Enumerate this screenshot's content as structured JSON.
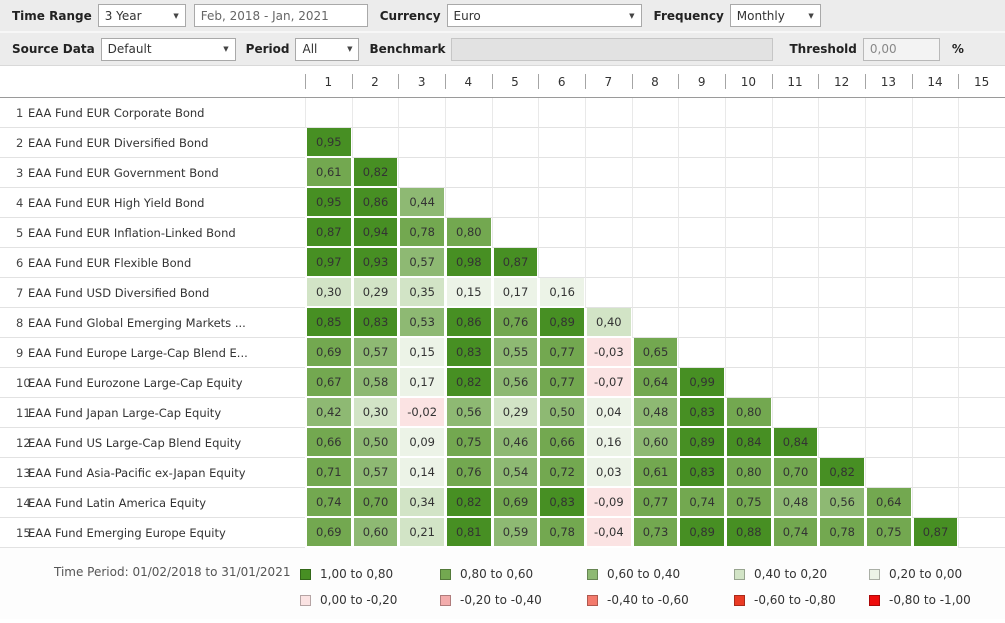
{
  "icons": {
    "dropdown_arrow": "▼"
  },
  "toolbar": {
    "time_range_label": "Time Range",
    "time_range_value": "3 Year",
    "date_range_value": "Feb, 2018 - Jan, 2021",
    "currency_label": "Currency",
    "currency_value": "Euro",
    "frequency_label": "Frequency",
    "frequency_value": "Monthly",
    "source_data_label": "Source Data",
    "source_data_value": "Default",
    "period_label": "Period",
    "period_value": "All",
    "benchmark_label": "Benchmark",
    "benchmark_value": "",
    "threshold_label": "Threshold",
    "threshold_value": "0,00",
    "threshold_unit": "%"
  },
  "footer": {
    "time_period": "Time Period: 01/02/2018 to 31/01/2021"
  },
  "chart_data": {
    "type": "heatmap",
    "title": "Correlation Matrix",
    "columns": [
      "1",
      "2",
      "3",
      "4",
      "5",
      "6",
      "7",
      "8",
      "9",
      "10",
      "11",
      "12",
      "13",
      "14",
      "15"
    ],
    "band_thresholds": [
      0.8,
      0.6,
      0.4,
      0.2,
      0,
      -0.2,
      -0.4,
      -0.6,
      -0.8
    ],
    "legend": {
      "items": [
        {
          "label": "1,00 to 0,80",
          "color": "#478f23"
        },
        {
          "label": "0,80 to 0,60",
          "color": "#73a850"
        },
        {
          "label": "0,60 to 0,40",
          "color": "#8eb973"
        },
        {
          "label": "0,40 to 0,20",
          "color": "#d2e4c6"
        },
        {
          "label": "0,20 to 0,00",
          "color": "#ecf3e7"
        },
        {
          "label": "0,00 to -0,20",
          "color": "#fbe3e3"
        },
        {
          "label": "-0,20 to -0,40",
          "color": "#f3acac"
        },
        {
          "label": "-0,40 to -0,60",
          "color": "#f37a6c"
        },
        {
          "label": "-0,60 to -0,80",
          "color": "#ea3b24"
        },
        {
          "label": "-0,80 to -1,00",
          "color": "#ee0c0c"
        }
      ]
    },
    "rows": [
      {
        "num": "1",
        "name": "EAA Fund EUR Corporate Bond",
        "values": []
      },
      {
        "num": "2",
        "name": "EAA Fund EUR Diversified Bond",
        "values": [
          "0,95"
        ]
      },
      {
        "num": "3",
        "name": "EAA Fund EUR Government Bond",
        "values": [
          "0,61",
          "0,82"
        ]
      },
      {
        "num": "4",
        "name": "EAA Fund EUR High Yield Bond",
        "values": [
          "0,95",
          "0,86",
          "0,44"
        ]
      },
      {
        "num": "5",
        "name": "EAA Fund EUR Inflation-Linked Bond",
        "values": [
          "0,87",
          "0,94",
          "0,78",
          "0,80"
        ]
      },
      {
        "num": "6",
        "name": "EAA Fund EUR Flexible Bond",
        "values": [
          "0,97",
          "0,93",
          "0,57",
          "0,98",
          "0,87"
        ]
      },
      {
        "num": "7",
        "name": "EAA Fund USD Diversified Bond",
        "values": [
          "0,30",
          "0,29",
          "0,35",
          "0,15",
          "0,17",
          "0,16"
        ]
      },
      {
        "num": "8",
        "name": "EAA Fund Global Emerging Markets ...",
        "values": [
          "0,85",
          "0,83",
          "0,53",
          "0,86",
          "0,76",
          "0,89",
          "0,40"
        ]
      },
      {
        "num": "9",
        "name": "EAA Fund Europe Large-Cap Blend E...",
        "values": [
          "0,69",
          "0,57",
          "0,15",
          "0,83",
          "0,55",
          "0,77",
          "-0,03",
          "0,65"
        ]
      },
      {
        "num": "10",
        "name": "EAA Fund Eurozone Large-Cap Equity",
        "values": [
          "0,67",
          "0,58",
          "0,17",
          "0,82",
          "0,56",
          "0,77",
          "-0,07",
          "0,64",
          "0,99"
        ]
      },
      {
        "num": "11",
        "name": "EAA Fund Japan Large-Cap Equity",
        "values": [
          "0,42",
          "0,30",
          "-0,02",
          "0,56",
          "0,29",
          "0,50",
          "0,04",
          "0,48",
          "0,83",
          "0,80"
        ]
      },
      {
        "num": "12",
        "name": "EAA Fund US Large-Cap Blend Equity",
        "values": [
          "0,66",
          "0,50",
          "0,09",
          "0,75",
          "0,46",
          "0,66",
          "0,16",
          "0,60",
          "0,89",
          "0,84",
          "0,84"
        ]
      },
      {
        "num": "13",
        "name": "EAA Fund Asia-Pacific ex-Japan Equity",
        "values": [
          "0,71",
          "0,57",
          "0,14",
          "0,76",
          "0,54",
          "0,72",
          "0,03",
          "0,61",
          "0,83",
          "0,80",
          "0,70",
          "0,82"
        ]
      },
      {
        "num": "14",
        "name": "EAA Fund Latin America Equity",
        "values": [
          "0,74",
          "0,70",
          "0,34",
          "0,82",
          "0,69",
          "0,83",
          "-0,09",
          "0,77",
          "0,74",
          "0,75",
          "0,48",
          "0,56",
          "0,64"
        ]
      },
      {
        "num": "15",
        "name": "EAA Fund Emerging Europe Equity",
        "values": [
          "0,69",
          "0,60",
          "0,21",
          "0,81",
          "0,59",
          "0,78",
          "-0,04",
          "0,73",
          "0,89",
          "0,88",
          "0,74",
          "0,78",
          "0,75",
          "0,87"
        ]
      }
    ]
  }
}
